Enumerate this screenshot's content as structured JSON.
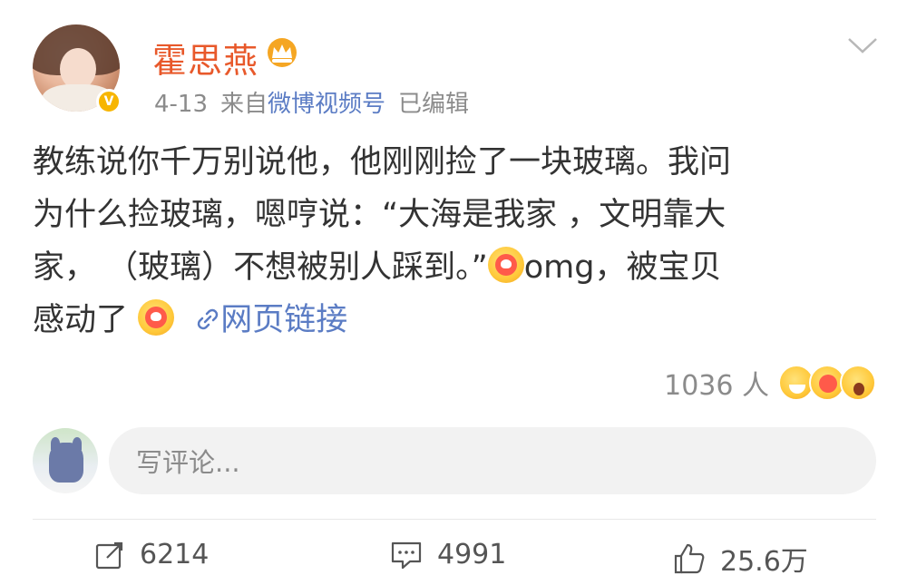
{
  "post": {
    "user": {
      "name": "霍思燕",
      "crown_icon": "crown-icon",
      "verified_icon": "verified-v-icon",
      "avatar": "user-avatar"
    },
    "meta": {
      "date": "4-13",
      "from_label": "来自",
      "source": "微博视频号",
      "edited": "已编辑"
    },
    "content": {
      "line1": "教练说你千万别说他，他刚刚捡了一块玻璃。我问",
      "line2": "为什么捡玻璃，嗯哼说：“大海是我家 ，文明靠大",
      "line3_a": "家，  （玻璃）不想被别人踩到。”",
      "line3_b": "omg，被宝贝",
      "line4_a": "感动了",
      "link_text": "网页链接",
      "emoji": "heart-face-emoji",
      "link_icon": "link-icon"
    },
    "reactions": {
      "count": "1036 人",
      "icons": [
        "grin-emoji",
        "heart-face-emoji",
        "surprised-emoji"
      ]
    },
    "comment": {
      "placeholder": "写评论..."
    },
    "footer": {
      "repost_count": "6214",
      "comment_count": "4991",
      "like_count": "25.6万"
    },
    "colors": {
      "username": "#e8592b",
      "link": "#5b7cc4",
      "meta": "#8b8b8b",
      "text": "#333333"
    }
  }
}
